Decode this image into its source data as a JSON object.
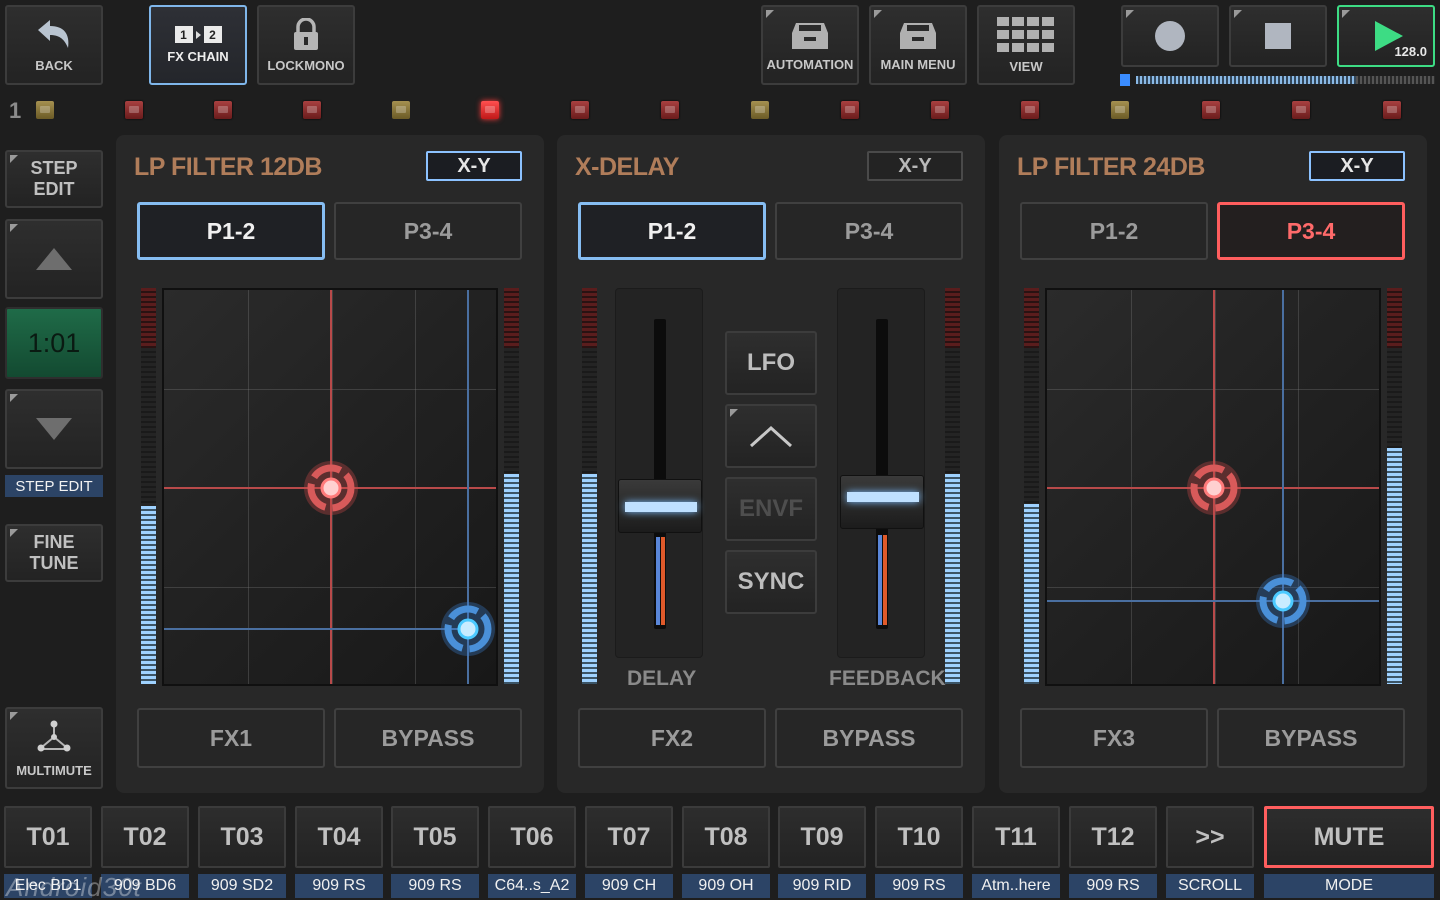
{
  "topbar": {
    "back": {
      "label": "BACK",
      "icon": "undo-arrow-icon"
    },
    "fx_chain": {
      "label": "FX CHAIN",
      "slot1": "1",
      "slot2": "2"
    },
    "lock_mono": {
      "label": "LOCKMONO",
      "icon": "lock-icon"
    },
    "automation": {
      "label": "AUTOMATION",
      "icon": "inbox-tray-icon"
    },
    "main_menu": {
      "label": "MAIN MENU",
      "icon": "inbox-tray-icon"
    },
    "view": {
      "label": "VIEW",
      "icon": "grid-view-icon"
    },
    "record": {
      "icon": "record-circle-icon"
    },
    "stop": {
      "icon": "stop-square-icon"
    },
    "play": {
      "icon": "play-triangle-icon",
      "tempo": "128.0"
    }
  },
  "step_row": {
    "index_label": "1"
  },
  "left_tools": {
    "step_edit_btn": {
      "line1": "STEP",
      "line2": "EDIT"
    },
    "up": {
      "icon": "triangle-up-icon"
    },
    "position": "1:01",
    "down": {
      "icon": "triangle-down-icon"
    },
    "step_edit_label": "STEP EDIT",
    "fine_tune": {
      "line1": "FINE",
      "line2": "TUNE"
    },
    "multimute": {
      "label": "MULTIMUTE",
      "icon": "network-node-icon"
    }
  },
  "panels": {
    "fx1": {
      "title": "LP FILTER 12DB",
      "xy": "X-Y",
      "p12": "P1-2",
      "p34": "P3-4",
      "fx": "FX1",
      "bypass": "BYPASS"
    },
    "fx2": {
      "title": "X-DELAY",
      "xy": "X-Y",
      "p12": "P1-2",
      "p34": "P3-4",
      "fx": "FX2",
      "bypass": "BYPASS",
      "delay_label": "DELAY",
      "feedback_label": "FEEDBACK",
      "lfo": "LFO",
      "envf": "ENVF",
      "sync": "SYNC",
      "lfo_up_icon": "chevron-up-icon"
    },
    "fx3": {
      "title": "LP FILTER 24DB",
      "xy": "X-Y",
      "p12": "P1-2",
      "p34": "P3-4",
      "fx": "FX3",
      "bypass": "BYPASS"
    }
  },
  "tracks": [
    {
      "id": "T01",
      "name": "Elec BD1"
    },
    {
      "id": "T02",
      "name": "909 BD6"
    },
    {
      "id": "T03",
      "name": "909 SD2"
    },
    {
      "id": "T04",
      "name": "909 RS"
    },
    {
      "id": "T05",
      "name": "909 RS"
    },
    {
      "id": "T06",
      "name": "C64..s_A2"
    },
    {
      "id": "T07",
      "name": "909 CH"
    },
    {
      "id": "T08",
      "name": "909 OH"
    },
    {
      "id": "T09",
      "name": "909 RID"
    },
    {
      "id": "T10",
      "name": "909 RS"
    },
    {
      "id": "T11",
      "name": "Atm..here"
    },
    {
      "id": "T12",
      "name": "909 RS"
    }
  ],
  "scroll": {
    "label": ">>",
    "caption": "SCROLL"
  },
  "mute": {
    "label": "MUTE",
    "caption": "MODE"
  },
  "watermark": "Android30t",
  "colors": {
    "accent_blue": "#86bdf2",
    "accent_red": "#ff5e5e",
    "panel_title": "#b07d5a",
    "play_green": "#3ddc84",
    "track_caption": "#2c4466"
  }
}
